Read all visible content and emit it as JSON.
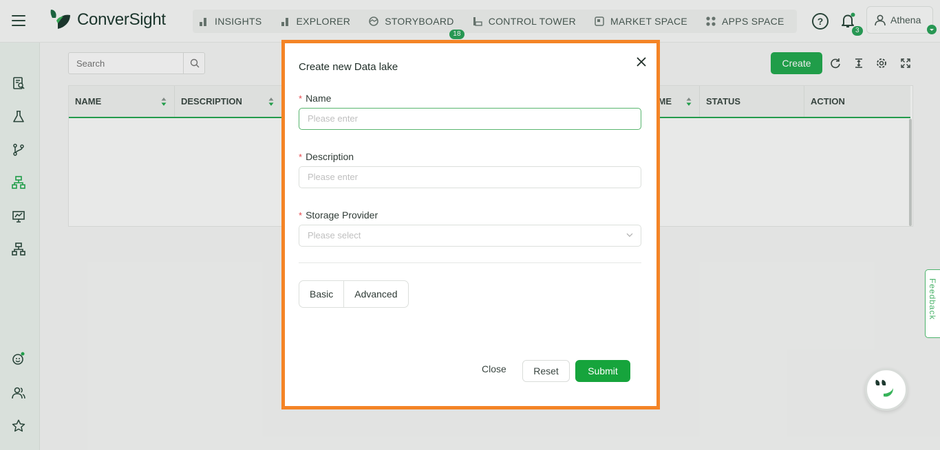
{
  "app": {
    "logo_text": "ConverSight",
    "brand_color": "#23a94f",
    "highlight_color": "#f48426"
  },
  "nav": [
    {
      "label": "INSIGHTS",
      "icon": "bar-chart-icon"
    },
    {
      "label": "EXPLORER",
      "icon": "bar-chart-icon"
    },
    {
      "label": "STORYBOARD",
      "icon": "storyboard-icon",
      "badge": "18"
    },
    {
      "label": "CONTROL TOWER",
      "icon": "tower-icon"
    },
    {
      "label": "MARKET SPACE",
      "icon": "market-icon"
    },
    {
      "label": "APPS SPACE",
      "icon": "apps-grid-icon"
    }
  ],
  "header": {
    "help_glyph": "?",
    "notification_count": "3",
    "user_name": "Athena"
  },
  "sidebar": {
    "items": [
      {
        "icon": "report-search-icon"
      },
      {
        "icon": "flask-icon"
      },
      {
        "icon": "branch-icon"
      },
      {
        "icon": "hierarchy-icon",
        "active": true
      },
      {
        "icon": "presentation-chart-icon"
      },
      {
        "icon": "hierarchy-icon"
      }
    ],
    "bottom": [
      {
        "icon": "bot-face-icon"
      },
      {
        "icon": "users-icon"
      },
      {
        "icon": "star-icon"
      }
    ]
  },
  "toolbar": {
    "search_placeholder": "Search",
    "create_label": "Create",
    "tools": [
      "refresh-icon",
      "column-height-icon",
      "settings-icon",
      "fullscreen-icon"
    ]
  },
  "table": {
    "columns": [
      "NAME",
      "DESCRIPTION",
      "",
      "",
      "",
      "ME",
      "STATUS",
      "ACTION"
    ]
  },
  "modal": {
    "title": "Create new Data lake",
    "fields": [
      {
        "label": "Name",
        "required": "*",
        "placeholder": "Please enter"
      },
      {
        "label": "Description",
        "required": "*",
        "placeholder": "Please enter"
      },
      {
        "label": "Storage Provider",
        "required": "*",
        "placeholder": "Please select"
      }
    ],
    "tabs": [
      "Basic",
      "Advanced"
    ],
    "buttons": {
      "close": "Close",
      "reset": "Reset",
      "submit": "Submit"
    }
  },
  "feedback_label": "Feedback"
}
